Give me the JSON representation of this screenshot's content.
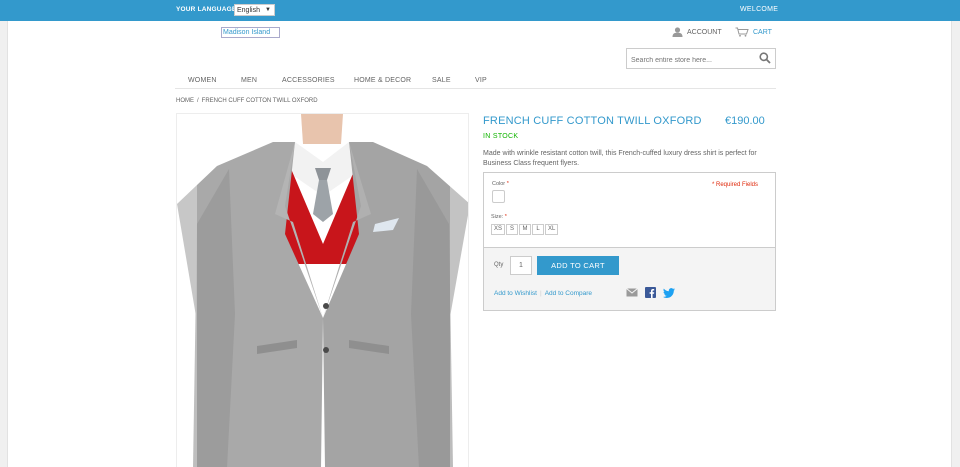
{
  "topbar": {
    "language_label": "YOUR LANGUAGE",
    "language_value": "English",
    "welcome": "WELCOME"
  },
  "header": {
    "logo_alt": "Madison Island",
    "account_label": "ACCOUNT",
    "cart_label": "CART",
    "search_placeholder": "Search entire store here..."
  },
  "nav": {
    "items": [
      "WOMEN",
      "MEN",
      "ACCESSORIES",
      "HOME & DECOR",
      "SALE",
      "VIP"
    ]
  },
  "breadcrumb": {
    "home": "HOME",
    "separator": "/",
    "current": "FRENCH CUFF COTTON TWILL OXFORD"
  },
  "product": {
    "name": "FRENCH CUFF COTTON TWILL OXFORD",
    "price": "€190.00",
    "availability": "IN STOCK",
    "description": "Made with wrinkle resistant cotton twill, this French-cuffed luxury dress shirt is perfect for Business Class frequent flyers."
  },
  "options": {
    "color_label": "Color",
    "size_label": "Size:",
    "required_mark": "*",
    "required_fields": "* Required Fields",
    "sizes": [
      "XS",
      "S",
      "M",
      "L",
      "XL"
    ]
  },
  "add_to_cart": {
    "qty_label": "Qty",
    "qty_value": "1",
    "button_label": "ADD TO CART",
    "wishlist_label": "Add to Wishlist",
    "compare_label": "Add to Compare"
  },
  "colors": {
    "accent": "#3399cc",
    "in_stock": "#11b400",
    "required": "#df280a",
    "suit": "#a8a8a8",
    "sweater": "#c8151b"
  }
}
